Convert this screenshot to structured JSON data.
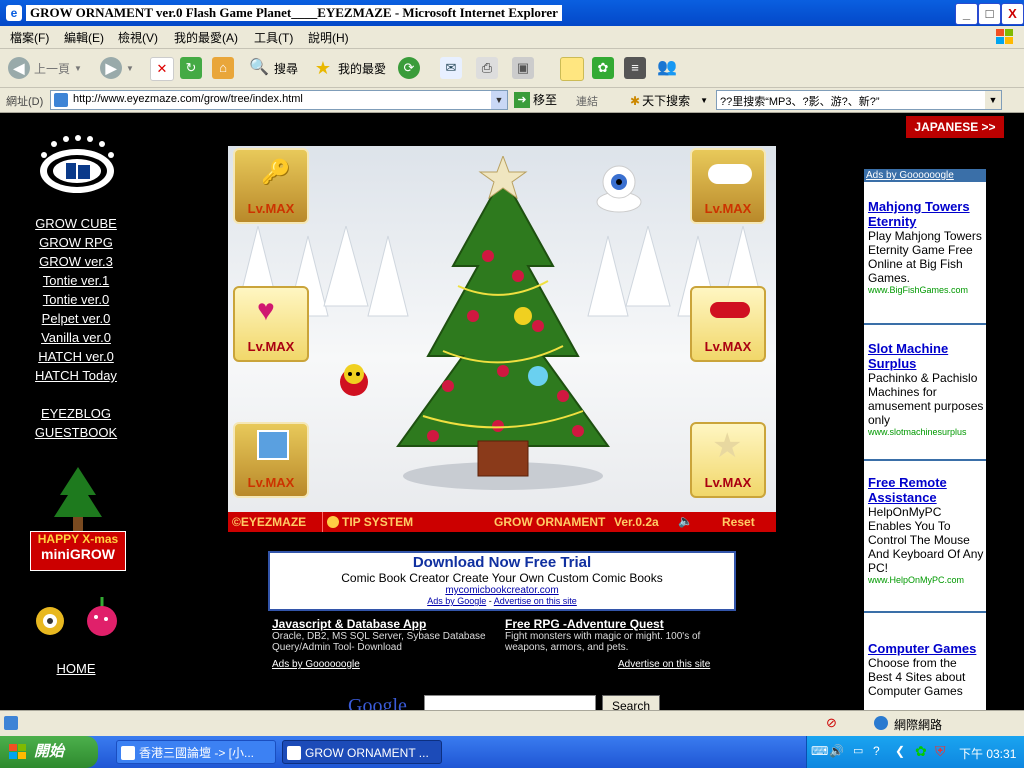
{
  "window": {
    "title": "GROW ORNAMENT ver.0 Flash Game Planet____EYEZMAZE - Microsoft Internet Explorer",
    "buttons": {
      "minimize": "_",
      "maximize": "□",
      "close": "X"
    }
  },
  "menu": [
    "檔案(F)",
    "編輯(E)",
    "檢視(V)",
    "我的最愛(A)",
    "工具(T)",
    "說明(H)"
  ],
  "toolbar": {
    "back_label": "上一頁",
    "search_label": "搜尋",
    "favorites_label": "我的最愛"
  },
  "address": {
    "label": "網址(D)",
    "url": "http://www.eyezmaze.com/grow/tree/index.html",
    "go_label": "移至",
    "links_label": "連結",
    "search_brand": "天下搜索",
    "search_placeholder": "??里搜索“MP3、?影、游?、新?”"
  },
  "sidebar": {
    "logo": "GROW",
    "links": [
      "GROW CUBE",
      "GROW RPG",
      "GROW ver.3",
      "Tontie ver.1",
      "Tontie ver.0",
      "Pelpet ver.0",
      "Vanilla ver.0",
      "HATCH ver.0",
      "HATCH Today"
    ],
    "links2": [
      "EYEZBLOG",
      "GUESTBOOK"
    ],
    "xmas_line1": "HAPPY X-mas",
    "xmas_line2": "miniGROW",
    "home": "HOME"
  },
  "japanese_button": "JAPANESE >>",
  "game": {
    "level_label": "Lv.MAX",
    "boxes": [
      "key",
      "cloud",
      "heart",
      "ribbon",
      "gift",
      "star"
    ],
    "bar": {
      "copyright": "©EYEZMAZE",
      "tip": "TIP SYSTEM",
      "name": "GROW ORNAMENT",
      "version": "Ver.0.2a",
      "reset": "Reset"
    }
  },
  "banner_ad": {
    "title": "Download Now Free Trial",
    "body": "Comic Book Creator Create Your Own Custom Comic Books",
    "url": "mycomicbookcreator.com",
    "ads_by": "Ads by Google",
    "advertise": "Advertise on this site"
  },
  "text_ads": [
    {
      "title": "Javascript & Database App",
      "body": "Oracle, DB2, MS SQL Server, Sybase Database Query/Admin Tool- Download"
    },
    {
      "title": "Free RPG -Adventure Quest",
      "body": "Fight monsters with magic or might. 100's of weapons, armors, and pets."
    }
  ],
  "text_ads_footer": {
    "ads_by": "Ads by Goooooogle",
    "advertise": "Advertise on this site"
  },
  "google_search": {
    "logo": "Google",
    "button": "Search"
  },
  "right_ads": {
    "header": "Ads by Goooooogle",
    "items": [
      {
        "title": "Mahjong Towers Eternity",
        "body": "Play Mahjong Towers Eternity Game Free Online at Big Fish Games.",
        "url": "www.BigFishGames.com"
      },
      {
        "title": "Slot Machine Surplus",
        "body": "Pachinko & Pachislo Machines for amusement purposes only",
        "url": "www.slotmachinesurplus"
      },
      {
        "title": "Free Remote Assistance",
        "body": "HelpOnMyPC Enables You To Control The Mouse And Keyboard Of Any PC!",
        "url": "www.HelpOnMyPC.com"
      },
      {
        "title": "Computer Games",
        "body": "Choose from the Best 4 Sites about Computer Games",
        "url": ""
      }
    ]
  },
  "statusbar": {
    "zone": "網際網路"
  },
  "taskbar": {
    "start": "開始",
    "tasks": [
      "香港三國論壇 -> [小...",
      "GROW ORNAMENT ..."
    ],
    "clock": "下午 03:31"
  }
}
